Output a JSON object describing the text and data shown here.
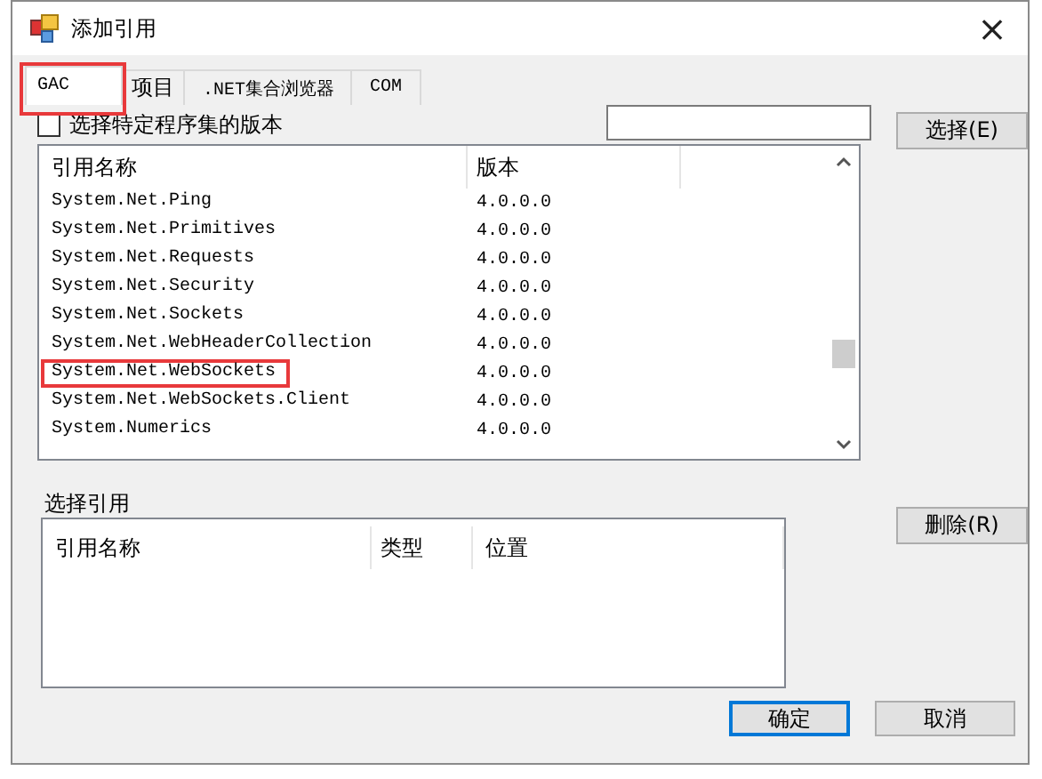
{
  "window": {
    "title": "添加引用",
    "close": "×"
  },
  "tabs": [
    {
      "label": "GAC",
      "selected": true,
      "highlighted": true
    },
    {
      "label": "项目",
      "selected": false,
      "highlighted": false
    },
    {
      "label": ".NET集合浏览器",
      "selected": false,
      "highlighted": false
    },
    {
      "label": "COM",
      "selected": false,
      "highlighted": false
    }
  ],
  "version_filter": {
    "label": "选择特定程序集的版本",
    "checked": false
  },
  "select_button": "选择(E)",
  "assembly_list": {
    "columns": [
      "引用名称",
      "版本"
    ],
    "rows": [
      {
        "name": "System.Net.Ping",
        "version": "4.0.0.0",
        "highlighted": false
      },
      {
        "name": "System.Net.Primitives",
        "version": "4.0.0.0",
        "highlighted": false
      },
      {
        "name": "System.Net.Requests",
        "version": "4.0.0.0",
        "highlighted": false
      },
      {
        "name": "System.Net.Security",
        "version": "4.0.0.0",
        "highlighted": false
      },
      {
        "name": "System.Net.Sockets",
        "version": "4.0.0.0",
        "highlighted": false
      },
      {
        "name": "System.Net.WebHeaderCollection",
        "version": "4.0.0.0",
        "highlighted": false
      },
      {
        "name": "System.Net.WebSockets",
        "version": "4.0.0.0",
        "highlighted": true
      },
      {
        "name": "System.Net.WebSockets.Client",
        "version": "4.0.0.0",
        "highlighted": false
      },
      {
        "name": "System.Numerics",
        "version": "4.0.0.0",
        "highlighted": false
      }
    ]
  },
  "selected_references": {
    "label": "选择引用",
    "columns": [
      "引用名称",
      "类型",
      "位置"
    ]
  },
  "remove_button": "删除(R)",
  "buttons": [
    {
      "label": "确定",
      "default": true
    },
    {
      "label": "取消",
      "default": false
    }
  ]
}
